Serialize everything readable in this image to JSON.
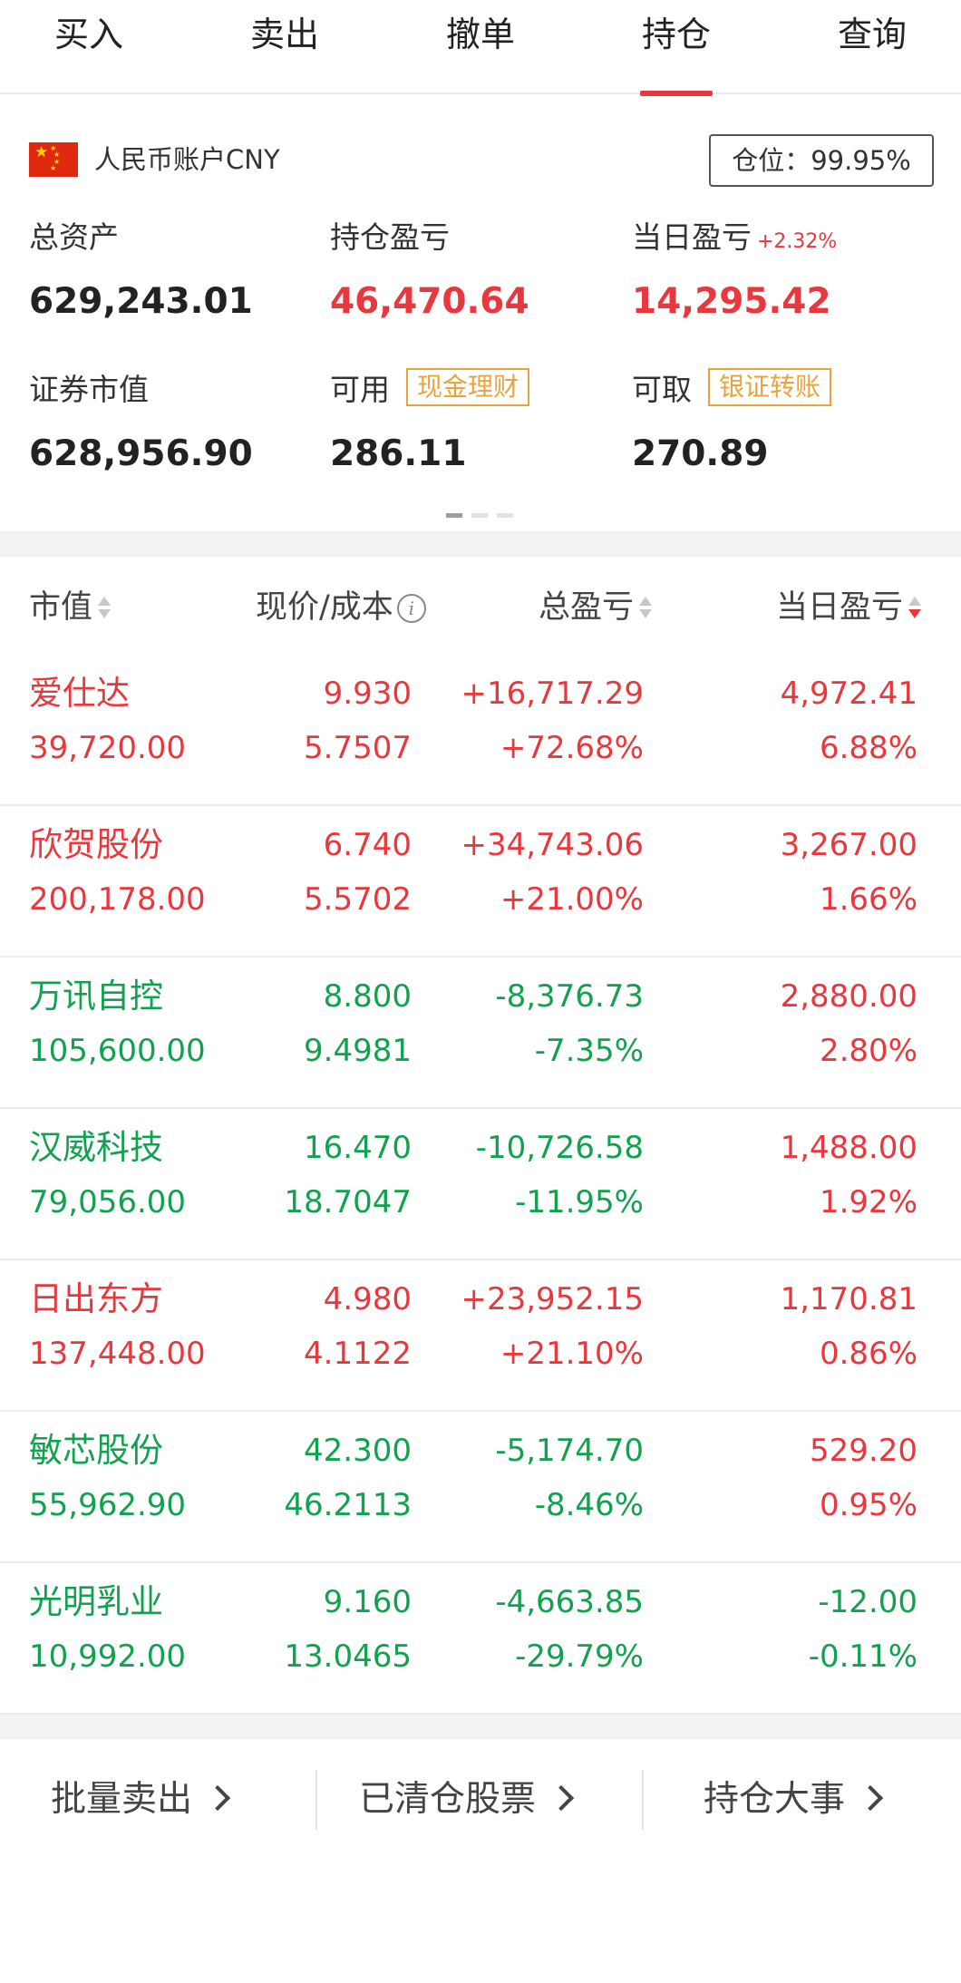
{
  "tabs": [
    {
      "label": "买入",
      "active": false
    },
    {
      "label": "卖出",
      "active": false
    },
    {
      "label": "撤单",
      "active": false
    },
    {
      "label": "持仓",
      "active": true
    },
    {
      "label": "查询",
      "active": false
    }
  ],
  "account": {
    "flag_icon": "china-flag-icon",
    "label": "人民币账户CNY",
    "position_ratio": "仓位：99.95%"
  },
  "summary": {
    "total_assets": {
      "label": "总资产",
      "value": "629,243.01"
    },
    "holding_pl": {
      "label": "持仓盈亏",
      "value": "46,470.64"
    },
    "daily_pl": {
      "label": "当日盈亏",
      "pct": "+2.32%",
      "value": "14,295.42"
    },
    "market_value": {
      "label": "证券市值",
      "value": "628,956.90"
    },
    "available": {
      "label": "可用",
      "tag": "现金理财",
      "value": "286.11"
    },
    "withdrawable": {
      "label": "可取",
      "tag": "银证转账",
      "value": "270.89"
    }
  },
  "pager": {
    "pages": 3,
    "current": 1
  },
  "table": {
    "headers": {
      "market_value": "市值",
      "price_cost": "现价/成本",
      "total_pl": "总盈亏",
      "daily_pl": "当日盈亏"
    },
    "sort_active": "daily_pl",
    "sort_direction": "desc",
    "rows": [
      {
        "name": "爱仕达",
        "market_value": "39,720.00",
        "price": "9.930",
        "cost": "5.7507",
        "total_pl": "+16,717.29",
        "total_pl_pct": "+72.68%",
        "daily_pl": "4,972.41",
        "daily_pl_pct": "6.88%",
        "trend": "up",
        "daily_trend": "up"
      },
      {
        "name": "欣贺股份",
        "market_value": "200,178.00",
        "price": "6.740",
        "cost": "5.5702",
        "total_pl": "+34,743.06",
        "total_pl_pct": "+21.00%",
        "daily_pl": "3,267.00",
        "daily_pl_pct": "1.66%",
        "trend": "up",
        "daily_trend": "up"
      },
      {
        "name": "万讯自控",
        "market_value": "105,600.00",
        "price": "8.800",
        "cost": "9.4981",
        "total_pl": "-8,376.73",
        "total_pl_pct": "-7.35%",
        "daily_pl": "2,880.00",
        "daily_pl_pct": "2.80%",
        "trend": "down",
        "daily_trend": "up"
      },
      {
        "name": "汉威科技",
        "market_value": "79,056.00",
        "price": "16.470",
        "cost": "18.7047",
        "total_pl": "-10,726.58",
        "total_pl_pct": "-11.95%",
        "daily_pl": "1,488.00",
        "daily_pl_pct": "1.92%",
        "trend": "down",
        "daily_trend": "up"
      },
      {
        "name": "日出东方",
        "market_value": "137,448.00",
        "price": "4.980",
        "cost": "4.1122",
        "total_pl": "+23,952.15",
        "total_pl_pct": "+21.10%",
        "daily_pl": "1,170.81",
        "daily_pl_pct": "0.86%",
        "trend": "up",
        "daily_trend": "up"
      },
      {
        "name": "敏芯股份",
        "market_value": "55,962.90",
        "price": "42.300",
        "cost": "46.2113",
        "total_pl": "-5,174.70",
        "total_pl_pct": "-8.46%",
        "daily_pl": "529.20",
        "daily_pl_pct": "0.95%",
        "trend": "down",
        "daily_trend": "up"
      },
      {
        "name": "光明乳业",
        "market_value": "10,992.00",
        "price": "9.160",
        "cost": "13.0465",
        "total_pl": "-4,663.85",
        "total_pl_pct": "-29.79%",
        "daily_pl": "-12.00",
        "daily_pl_pct": "-0.11%",
        "trend": "down",
        "daily_trend": "down"
      }
    ]
  },
  "footer": {
    "batch_sell": "批量卖出",
    "cleared_stocks": "已清仓股票",
    "holding_events": "持仓大事"
  },
  "colors": {
    "up": "#e8383d",
    "down": "#12a14f",
    "accent_tag": "#e8a33d"
  }
}
